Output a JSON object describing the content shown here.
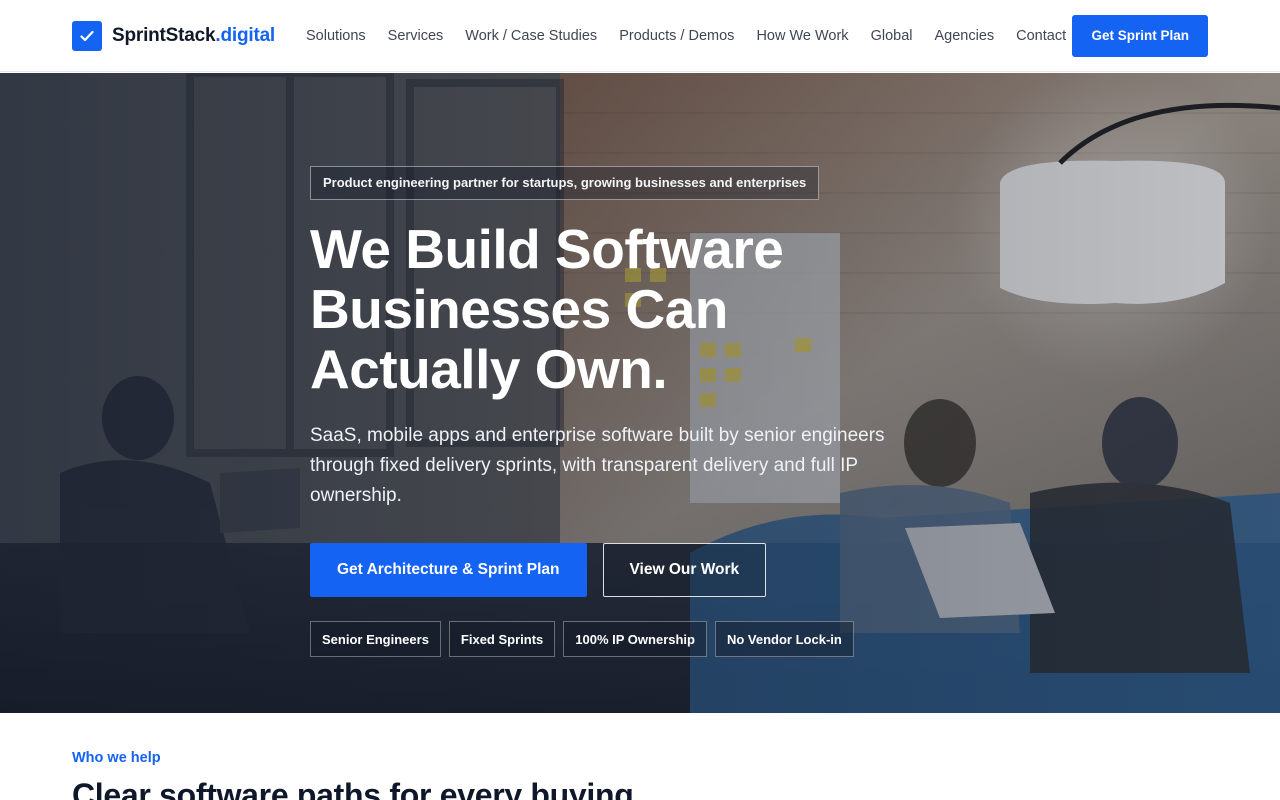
{
  "header": {
    "brand": {
      "name": "SprintStack",
      "suffix": ".digital",
      "logo_icon": "check-icon"
    },
    "nav": [
      {
        "label": "Solutions"
      },
      {
        "label": "Services"
      },
      {
        "label": "Work / Case Studies"
      },
      {
        "label": "Products / Demos"
      },
      {
        "label": "How We Work"
      },
      {
        "label": "Global"
      },
      {
        "label": "Agencies"
      },
      {
        "label": "Contact"
      }
    ],
    "cta_label": "Get Sprint Plan"
  },
  "hero": {
    "eyebrow": "Product engineering partner for startups, growing businesses and enterprises",
    "title": "We Build Software Businesses Can Actually Own.",
    "subtitle": "SaaS, mobile apps and enterprise software built by senior engineers through fixed delivery sprints, with transparent delivery and full IP ownership.",
    "primary_cta": "Get Architecture & Sprint Plan",
    "secondary_cta": "View Our Work",
    "chips": [
      {
        "label": "Senior Engineers"
      },
      {
        "label": "Fixed Sprints"
      },
      {
        "label": "100% IP Ownership"
      },
      {
        "label": "No Vendor Lock-in"
      }
    ]
  },
  "section": {
    "eyebrow": "Who we help",
    "title": "Clear software paths for every buying"
  },
  "colors": {
    "accent": "#1463f3",
    "text_dark": "#111827",
    "nav_text": "#3f4654"
  }
}
